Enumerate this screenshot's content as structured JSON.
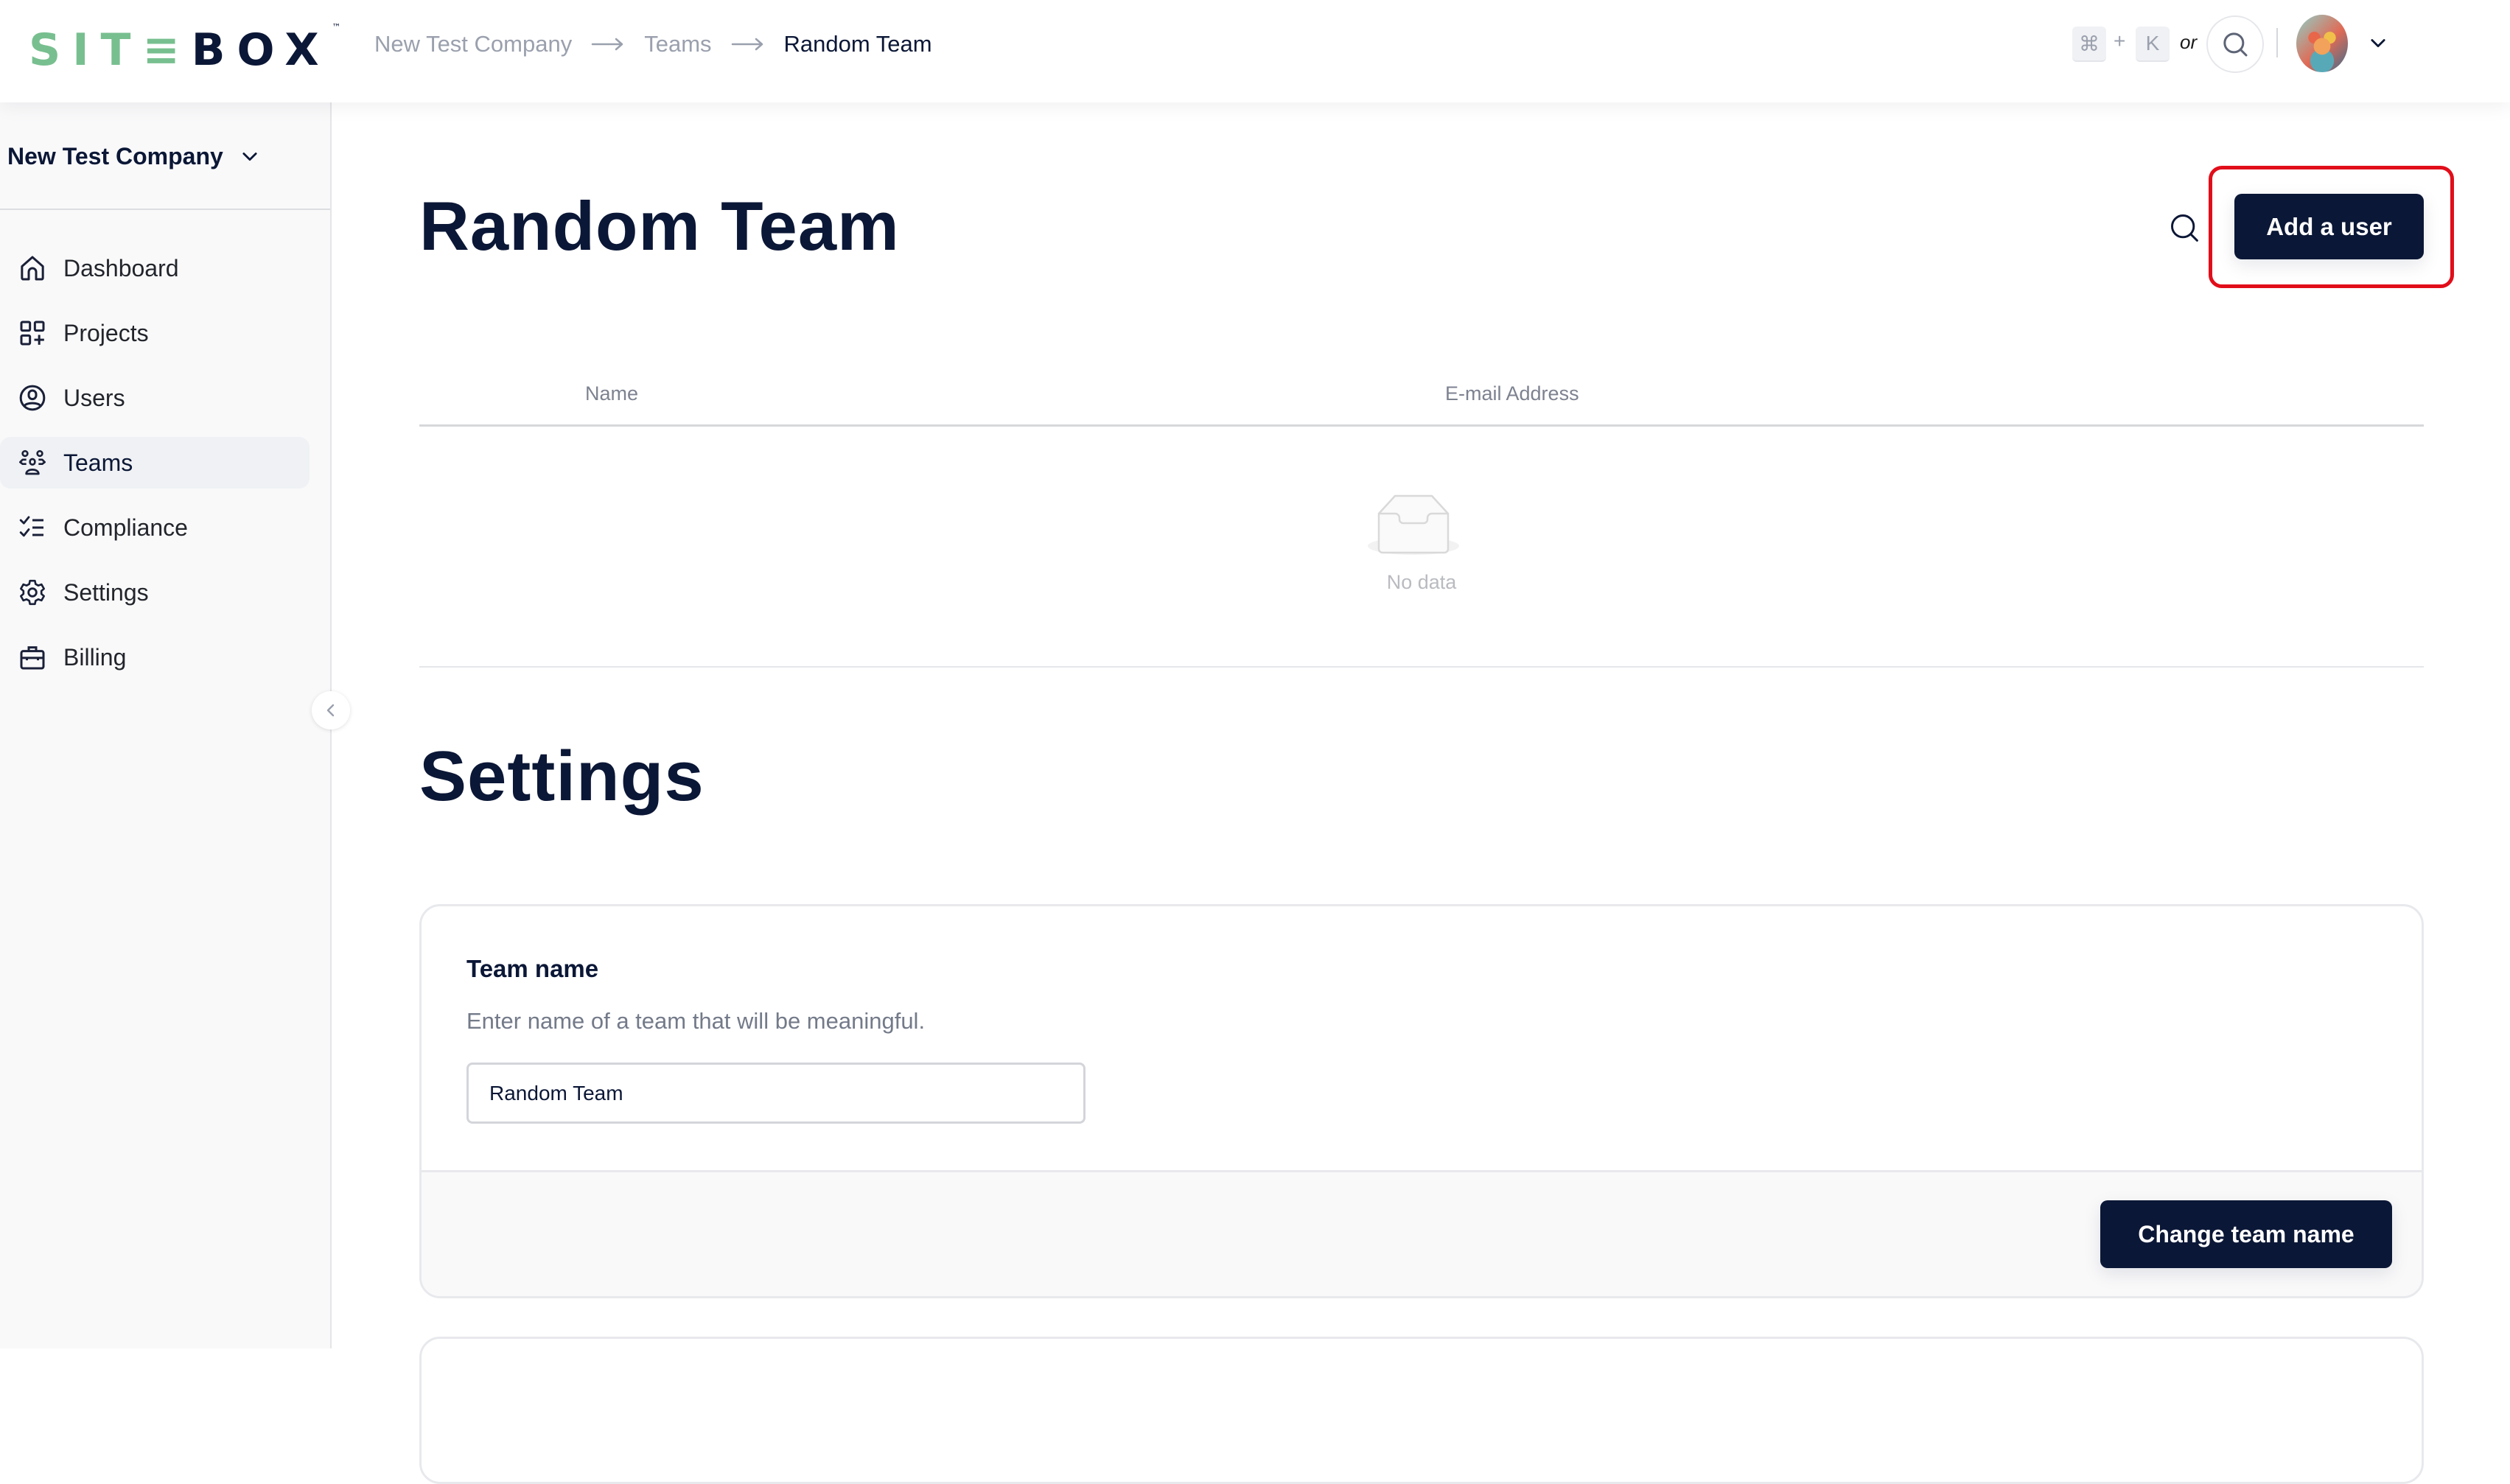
{
  "app": {
    "logo_left": "SIT",
    "logo_mid": "≡",
    "logo_right": "BOX",
    "logo_tm": "™"
  },
  "breadcrumb": {
    "items": [
      "New Test Company",
      "Teams",
      "Random Team"
    ],
    "separator_icon": "arrow-right-icon"
  },
  "header": {
    "shortcut_keys": [
      "⌘",
      "K"
    ],
    "shortcut_plus": "+",
    "shortcut_or": "or",
    "search_icon": "search-icon",
    "avatar_alt": "user avatar",
    "avatar_menu_icon": "chevron-down-icon"
  },
  "sidebar": {
    "company": "New Test Company",
    "items": [
      {
        "label": "Dashboard",
        "icon": "home-icon",
        "active": false
      },
      {
        "label": "Projects",
        "icon": "projects-grid-icon",
        "active": false
      },
      {
        "label": "Users",
        "icon": "user-circle-icon",
        "active": false
      },
      {
        "label": "Teams",
        "icon": "team-icon",
        "active": true
      },
      {
        "label": "Compliance",
        "icon": "checklist-icon",
        "active": false
      },
      {
        "label": "Settings",
        "icon": "gear-icon",
        "active": false
      },
      {
        "label": "Billing",
        "icon": "briefcase-icon",
        "active": false
      }
    ],
    "collapse_icon": "chevron-left-icon"
  },
  "main": {
    "title": "Random Team",
    "add_user_label": "Add a user",
    "table": {
      "columns": [
        "Name",
        "E-mail Address"
      ],
      "rows": [],
      "empty_text": "No data"
    },
    "settings_title": "Settings",
    "team_name_card": {
      "label": "Team name",
      "description": "Enter name of a team that will be meaningful.",
      "input_value": "Random Team",
      "submit_label": "Change team name"
    }
  },
  "colors": {
    "brand_navy": "#0b1736",
    "brand_green": "#78bf8f",
    "highlight_red": "#e10e1a",
    "active_nav_bg": "#eff1f4"
  }
}
